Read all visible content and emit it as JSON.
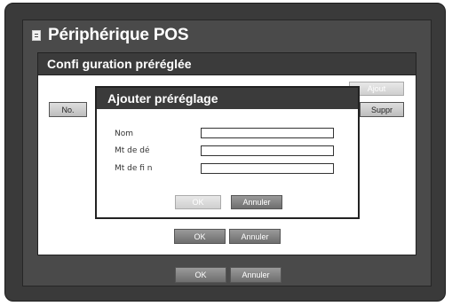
{
  "window": {
    "title": "Périphérique POS",
    "ok_label": "OK",
    "cancel_label": "Annuler"
  },
  "preset_panel": {
    "title": "Confi guration préréglée",
    "add_label": "Ajout",
    "delete_label": "Suppr",
    "columns": [
      "No."
    ],
    "ok_label": "OK",
    "cancel_label": "Annuler"
  },
  "dialog": {
    "title": "Ajouter préréglage",
    "fields": [
      {
        "label": "Nom",
        "value": ""
      },
      {
        "label": "Mt de dé",
        "value": ""
      },
      {
        "label": "Mt de fi n",
        "value": ""
      }
    ],
    "ok_label": "OK",
    "cancel_label": "Annuler"
  },
  "icons": {
    "title_icon": "document-icon"
  }
}
